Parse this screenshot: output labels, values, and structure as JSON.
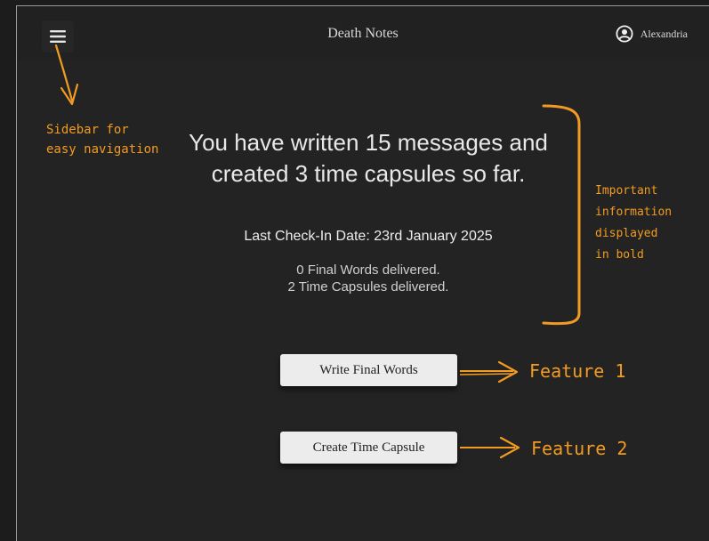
{
  "header": {
    "app_title": "Death Notes",
    "user_name": "Alexandria"
  },
  "summary": {
    "headline": "You have written 15 messages and created 3 time capsules so far.",
    "checkin": "Last Check-In Date: 23rd January 2025",
    "final_words_delivered": "0 Final Words delivered.",
    "time_capsules_delivered": "2 Time Capsules delivered."
  },
  "actions": {
    "write_final_words": "Write Final Words",
    "create_time_capsule": "Create Time Capsule"
  },
  "annotations": {
    "sidebar_line1": "Sidebar for",
    "sidebar_line2": "easy navigation",
    "important_line1": "Important",
    "important_line2": "information",
    "important_line3": "displayed",
    "important_line4": "in bold",
    "feature1": "Feature 1",
    "feature2": "Feature 2"
  },
  "colors": {
    "background": "#232323",
    "topbar": "#212121",
    "button": "#ececec",
    "annotation": "#f29b22"
  },
  "icons": [
    "hamburger-menu-icon",
    "user-circle-icon"
  ]
}
